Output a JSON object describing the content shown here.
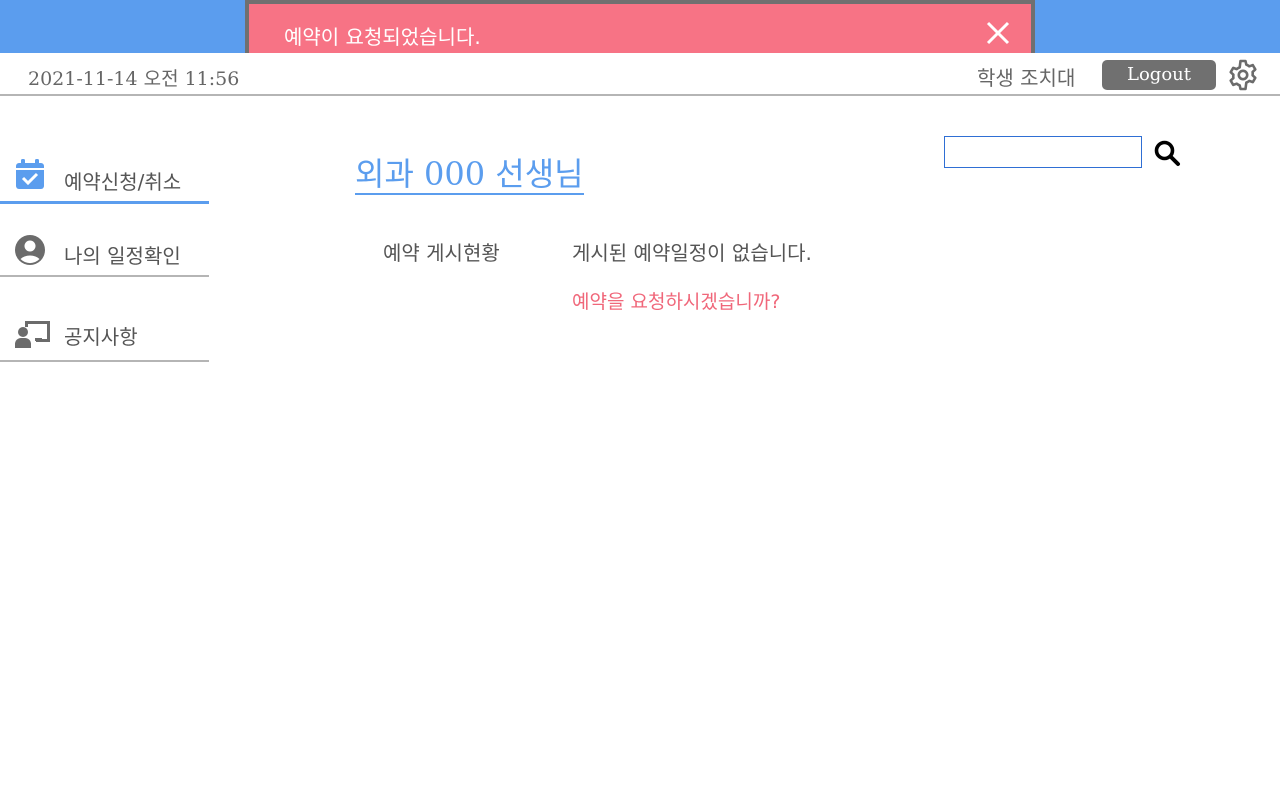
{
  "toast": {
    "message": "예약이 요청되었습니다.",
    "close_icon": "close-icon",
    "background": "#f77385"
  },
  "header": {
    "datetime": "2021-11-14 오전 11:56",
    "user": "학생 조치대",
    "logout_label": "Logout",
    "settings_icon": "gear-icon",
    "bar_color": "#5b9dee"
  },
  "sidebar": {
    "items": [
      {
        "label": "예약신청/취소",
        "icon": "calendar-check-icon",
        "active": true
      },
      {
        "label": "나의 일정확인",
        "icon": "user-circle-icon",
        "active": false
      },
      {
        "label": "공지사항",
        "icon": "chalkboard-teacher-icon",
        "active": false
      }
    ]
  },
  "main": {
    "title": "외과 000 선생님",
    "search": {
      "value": "",
      "placeholder": "",
      "icon": "search-icon"
    },
    "status_label": "예약 게시현황",
    "empty_message": "게시된 예약일정이 없습니다.",
    "request_prompt": "예약을 요청하시겠습니까?"
  },
  "colors": {
    "accent": "#5b9dee",
    "alert": "#f77385",
    "muted": "#707070"
  }
}
